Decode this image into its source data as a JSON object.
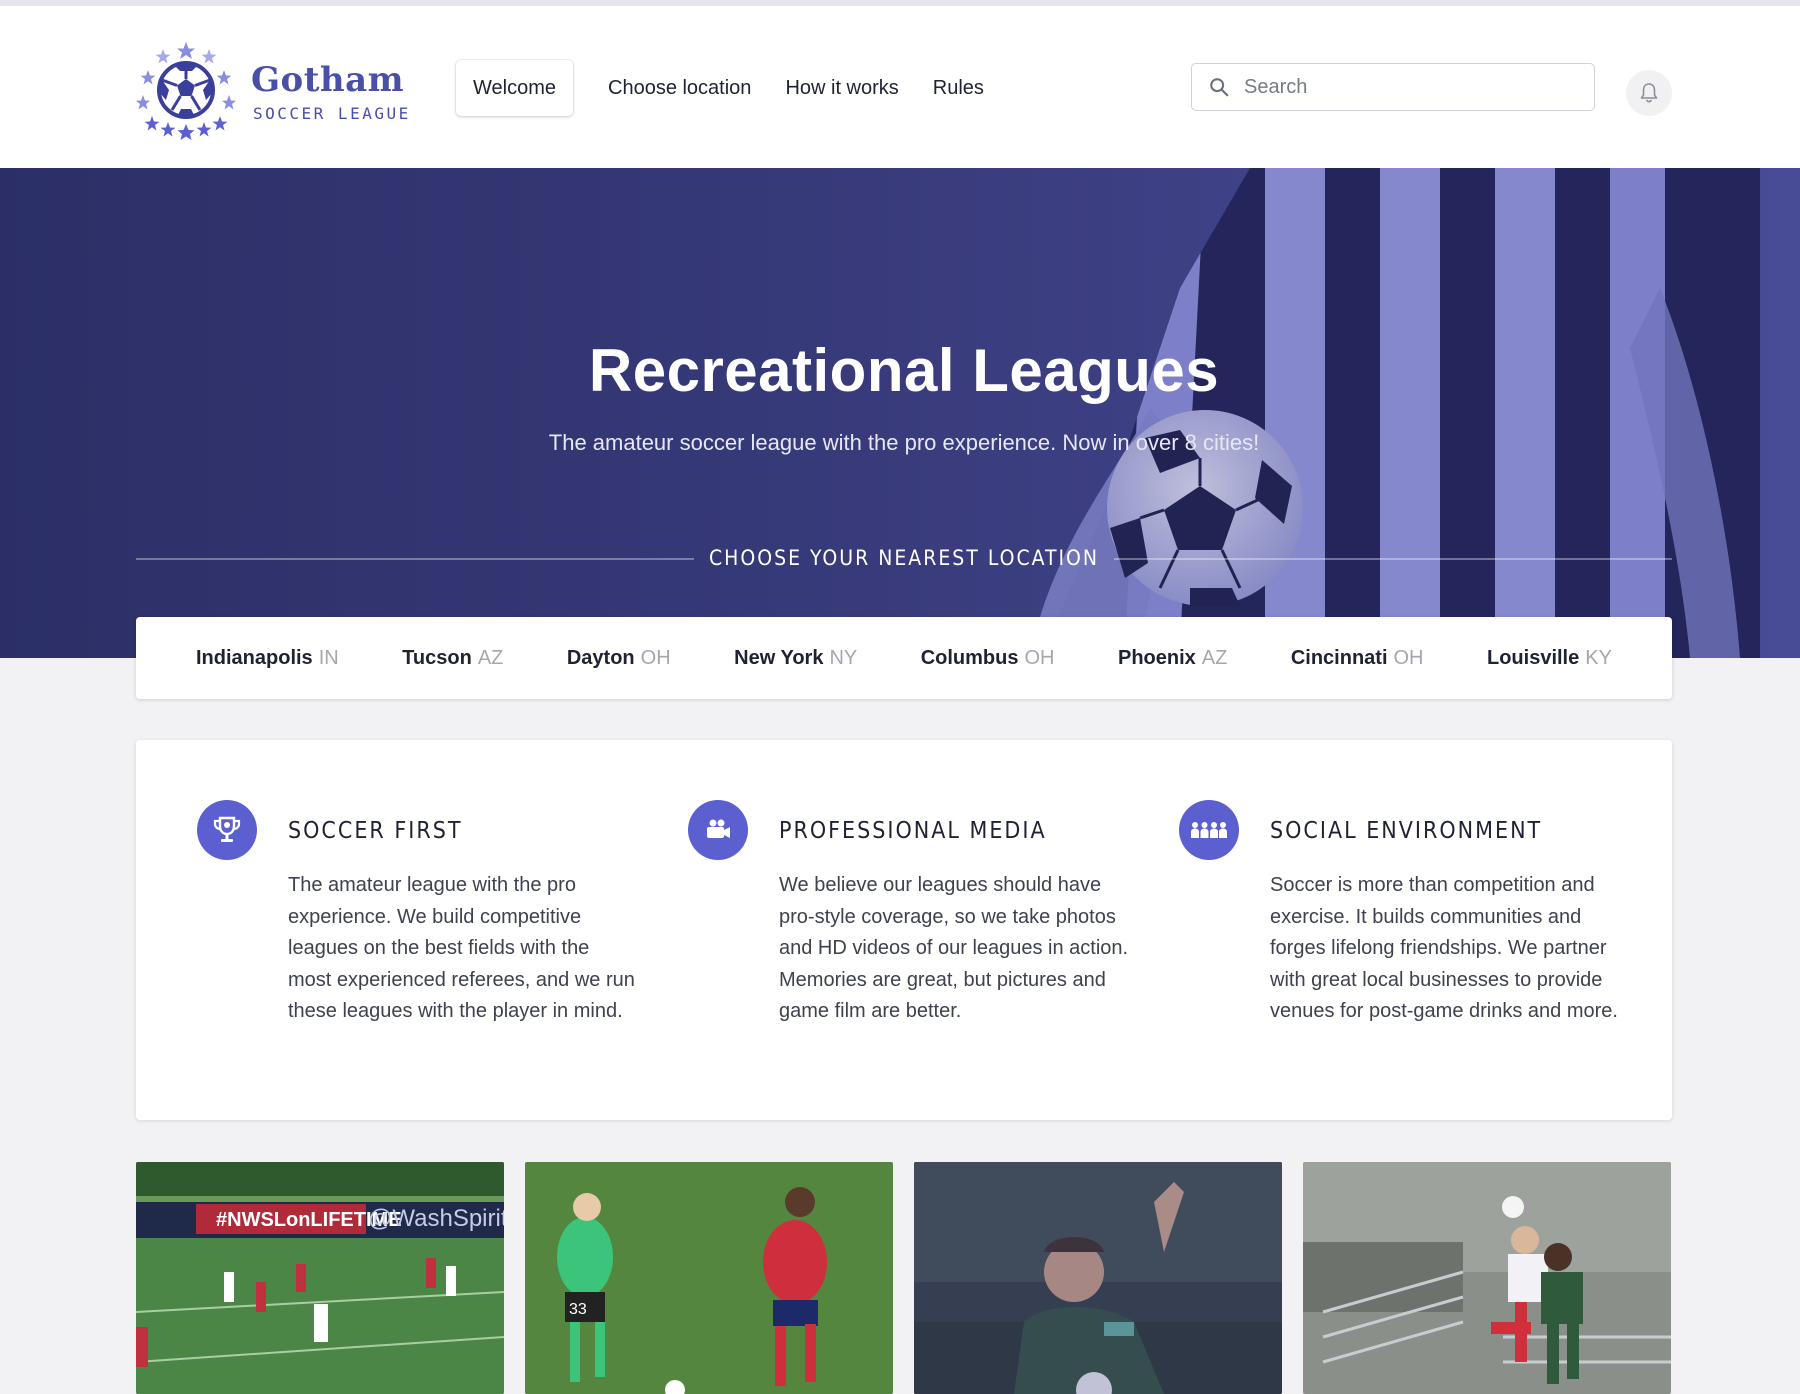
{
  "brand": {
    "name": "Gotham",
    "tagline": "SOCCER LEAGUE",
    "color": "#4a4fa8"
  },
  "nav": {
    "items": [
      {
        "label": "Welcome",
        "active": true
      },
      {
        "label": "Choose location",
        "active": false
      },
      {
        "label": "How it works",
        "active": false
      },
      {
        "label": "Rules",
        "active": false
      }
    ]
  },
  "search": {
    "placeholder": "Search",
    "icon": "search-icon"
  },
  "notifications": {
    "icon": "bell-icon"
  },
  "hero": {
    "title": "Recreational Leagues",
    "subtitle": "The amateur soccer league with the pro experience. Now in over 8 cities!",
    "choose_label": "CHOOSE YOUR NEAREST LOCATION"
  },
  "locations": [
    {
      "city": "Indianapolis",
      "state": "IN"
    },
    {
      "city": "Tucson",
      "state": "AZ"
    },
    {
      "city": "Dayton",
      "state": "OH"
    },
    {
      "city": "New York",
      "state": "NY"
    },
    {
      "city": "Columbus",
      "state": "OH"
    },
    {
      "city": "Phoenix",
      "state": "AZ"
    },
    {
      "city": "Cincinnati",
      "state": "OH"
    },
    {
      "city": "Louisville",
      "state": "KY"
    }
  ],
  "features": [
    {
      "icon": "trophy-icon",
      "title": "SOCCER FIRST",
      "text": "The amateur league with the pro experience. We build competitive leagues on the best fields with the most experienced referees, and we run these leagues with the player in mind."
    },
    {
      "icon": "video-camera-icon",
      "title": "PROFESSIONAL MEDIA",
      "text": "We believe our leagues should have pro-style coverage, so we take photos and HD videos of our leagues in action. Memories are great, but pictures and game film are better."
    },
    {
      "icon": "people-group-icon",
      "title": "SOCIAL ENVIRONMENT",
      "text": "Soccer is more than competition and exercise. It builds communities and forges lifelong friendships. We partner with great local businesses to provide venues for post-game drinks and more."
    }
  ],
  "photos": [
    {
      "banner_text_1": "#NWSLonLIFETIME",
      "banner_text_2": "@WashSpirit"
    },
    {
      "jersey_number": "33"
    },
    {},
    {}
  ],
  "colors": {
    "accent": "#5b5fd0",
    "hero_bg": "#3a3d7e"
  }
}
